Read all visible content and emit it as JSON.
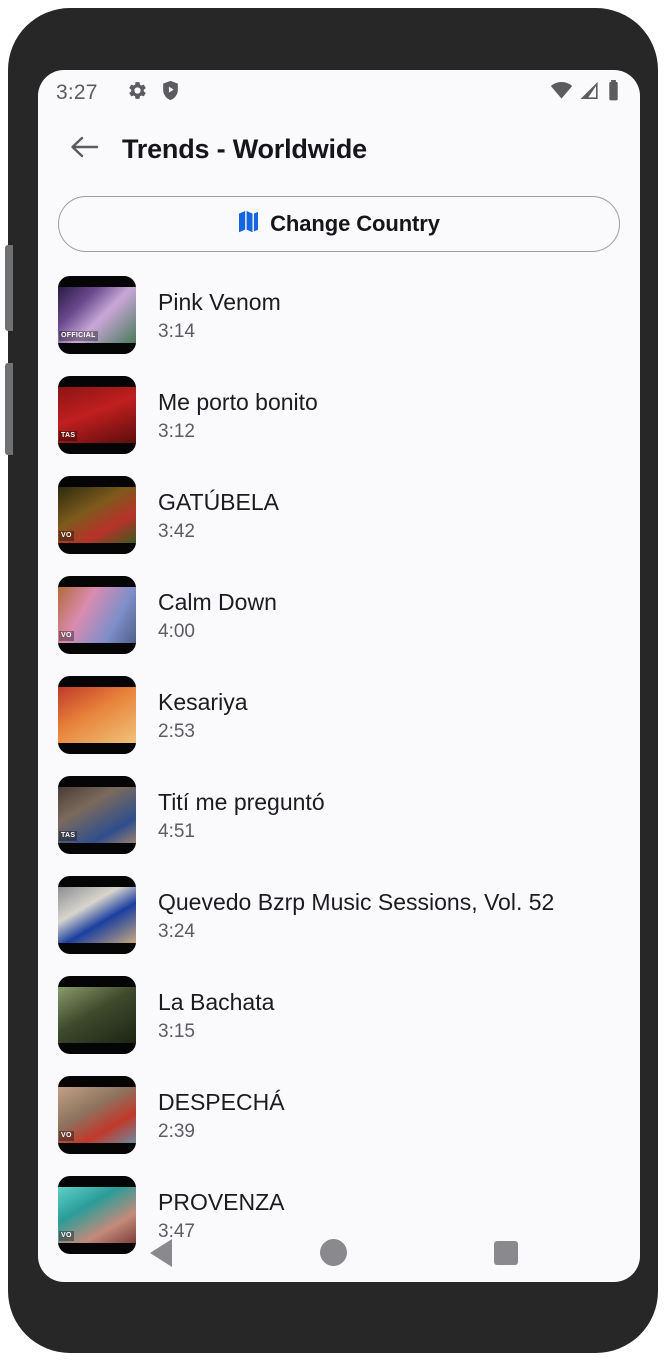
{
  "status_bar": {
    "time": "3:27",
    "left_icons": [
      "gear-icon",
      "shield-play-icon"
    ],
    "right_icons": [
      "wifi-icon",
      "cellular-signal-icon",
      "battery-icon"
    ]
  },
  "header": {
    "back_icon": "arrow-left-icon",
    "title": "Trends - Worldwide"
  },
  "change_country": {
    "label": "Change Country",
    "icon": "map-icon",
    "icon_color": "#1565e0"
  },
  "tracks": [
    {
      "title": "Pink Venom",
      "duration": "3:14",
      "tag": "OFFICIAL"
    },
    {
      "title": "Me porto bonito",
      "duration": "3:12",
      "tag": "TAS"
    },
    {
      "title": "GATÚBELA",
      "duration": "3:42",
      "tag": "VO"
    },
    {
      "title": "Calm Down",
      "duration": "4:00",
      "tag": "VO"
    },
    {
      "title": "Kesariya",
      "duration": "2:53",
      "tag": ""
    },
    {
      "title": "Tití me preguntó",
      "duration": "4:51",
      "tag": "TAS"
    },
    {
      "title": "Quevedo Bzrp Music Sessions, Vol. 52",
      "duration": "3:24",
      "tag": ""
    },
    {
      "title": "La Bachata",
      "duration": "3:15",
      "tag": ""
    },
    {
      "title": "DESPECHÁ",
      "duration": "2:39",
      "tag": "VO"
    },
    {
      "title": "PROVENZA",
      "duration": "3:47",
      "tag": "VO"
    }
  ],
  "nav_bar": {
    "back_label": "back",
    "home_label": "home",
    "recents_label": "recents"
  },
  "colors": {
    "screen_background": "#fafafd",
    "bezel": "#272727",
    "title_text": "#16161a",
    "secondary_text": "#5c5c63",
    "accent_blue": "#1565e0",
    "nav_icon": "#8a8a8e"
  }
}
